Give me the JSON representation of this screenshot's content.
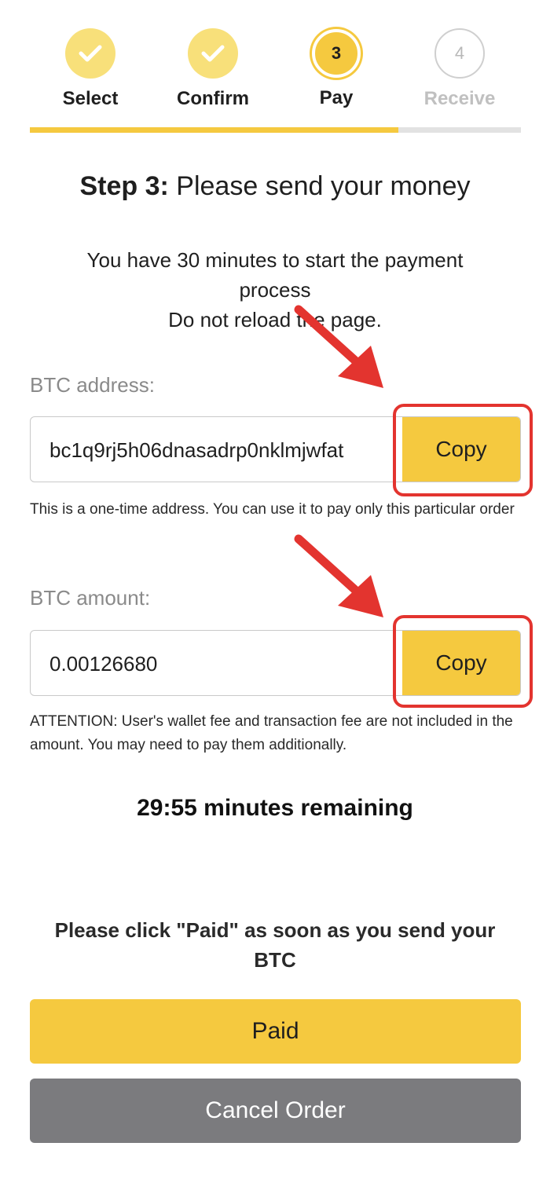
{
  "stepper": {
    "steps": [
      {
        "label": "Select",
        "state": "done",
        "icon": "check-icon"
      },
      {
        "label": "Confirm",
        "state": "done",
        "icon": "check-icon"
      },
      {
        "label": "Pay",
        "state": "active",
        "number": "3"
      },
      {
        "label": "Receive",
        "state": "future",
        "number": "4"
      }
    ],
    "progress_fraction": 0.75
  },
  "heading": {
    "prefix": "Step 3:",
    "text": " Please send your money"
  },
  "notice": {
    "line1": "You have 30 minutes to start the payment process",
    "line2": "Do not reload the page."
  },
  "btc_address": {
    "label": "BTC address:",
    "value": "bc1q9rj5h06dnasadrp0nklmjwfat",
    "copy_label": "Copy",
    "hint": "This is a one-time address. You can use it to pay only this particular order"
  },
  "btc_amount": {
    "label": "BTC amount:",
    "value": "0.00126680",
    "copy_label": "Copy",
    "hint": "ATTENTION: User's wallet fee and transaction fee are not included in the amount. You may need to pay them additionally."
  },
  "timer": {
    "text": "29:55 minutes remaining"
  },
  "paid_prompt": "Please click \"Paid\" as soon as you send your BTC",
  "buttons": {
    "paid": "Paid",
    "cancel": "Cancel Order"
  },
  "colors": {
    "accent": "#f5c93f",
    "accent_light": "#f8e07a",
    "annotation": "#e3342f",
    "cancel": "#7b7b7e"
  }
}
